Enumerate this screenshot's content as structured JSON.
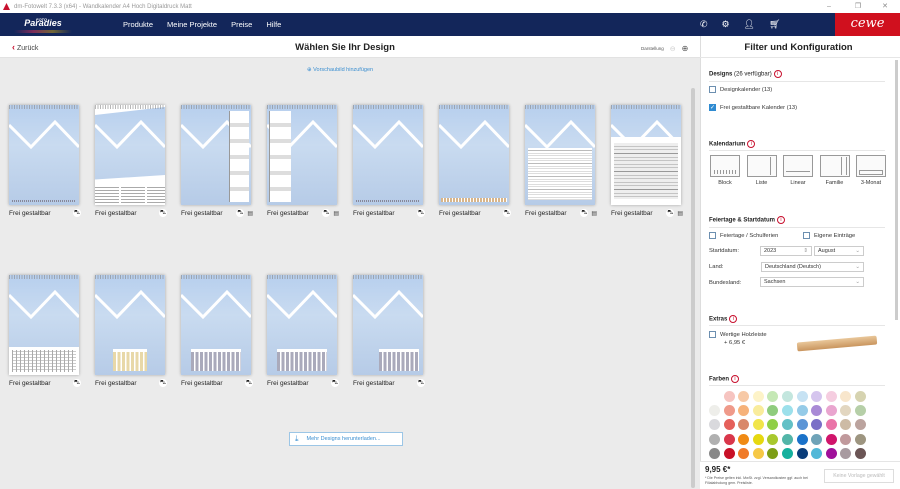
{
  "window": {
    "title": "dm-Fotowelt 7.3.3 (x64) - Wandkalender A4 Hoch Digitaldruck Matt",
    "minimize": "–",
    "maximize": "❐",
    "close": "✕"
  },
  "nav": {
    "logo": "Paradies",
    "logo_top": "FOTO",
    "links": [
      "Produkte",
      "Meine Projekte",
      "Preise",
      "Hilfe"
    ],
    "brand": "cewe",
    "icons": [
      "phone-icon",
      "gear-icon",
      "user-icon",
      "cart-icon"
    ]
  },
  "subheader": {
    "back": "Zurück",
    "title": "Wählen Sie Ihr Design",
    "zoom_label": "Darstellung"
  },
  "main": {
    "add_preview": "Vorschaubild hinzufügen",
    "more_designs": "Mehr Designs herunterladen...",
    "cards": [
      {
        "label": "Frei gestaltbar",
        "variant": "plain",
        "extra_icon": false
      },
      {
        "label": "Frei gestaltbar",
        "variant": "calendar-bottom",
        "extra_icon": false
      },
      {
        "label": "Frei gestaltbar",
        "variant": "list-right",
        "extra_icon": true
      },
      {
        "label": "Frei gestaltbar",
        "variant": "list-left",
        "extra_icon": true
      },
      {
        "label": "Frei gestaltbar",
        "variant": "plain",
        "extra_icon": false
      },
      {
        "label": "Frei gestaltbar",
        "variant": "linear",
        "extra_icon": false
      },
      {
        "label": "Frei gestaltbar",
        "variant": "planner",
        "extra_icon": true
      },
      {
        "label": "Frei gestaltbar",
        "variant": "family",
        "extra_icon": true
      },
      {
        "label": "Frei gestaltbar",
        "variant": "three-month",
        "extra_icon": false
      },
      {
        "label": "Frei gestaltbar",
        "variant": "block-small",
        "extra_icon": false
      },
      {
        "label": "Frei gestaltbar",
        "variant": "block",
        "extra_icon": false
      },
      {
        "label": "Frei gestaltbar",
        "variant": "block",
        "extra_icon": false
      },
      {
        "label": "Frei gestaltbar",
        "variant": "block-right",
        "extra_icon": false
      }
    ]
  },
  "panel": {
    "title": "Filter und Konfiguration",
    "designs": {
      "heading": "Designs",
      "count": "(26 verfügbar)",
      "options": [
        {
          "label": "Designkalender (13)",
          "checked": false
        },
        {
          "label": "Frei gestaltbare Kalender (13)",
          "checked": true
        }
      ]
    },
    "kalendarium": {
      "heading": "Kalendarium",
      "types": [
        "Block",
        "Liste",
        "Linear",
        "Familie",
        "3-Monat"
      ]
    },
    "feiertage": {
      "heading": "Feiertage & Startdatum",
      "holidays": "Feiertage / Schulferien",
      "own": "Eigene Einträge",
      "start_label": "Startdatum:",
      "year": "2023",
      "month": "August",
      "country_label": "Land:",
      "country": "Deutschland (Deutsch)",
      "state_label": "Bundesland:",
      "state": "Sachsen"
    },
    "extras": {
      "heading": "Extras",
      "item": "Wertige Holzleiste",
      "price": "+ 6,95 €"
    },
    "farben": {
      "heading": "Farben",
      "colors": [
        "#ffffff",
        "#f6c4c0",
        "#f7c9a6",
        "#fdf3c8",
        "#c5e8b5",
        "#c3e6de",
        "#c6e2f3",
        "#d5c5ee",
        "#f5cde0",
        "#f8e6cc",
        "#d6d3b0",
        "#eeeeea",
        "#ef9a8a",
        "#f6b27a",
        "#f9ec9c",
        "#8fcc7d",
        "#9ce0eb",
        "#95cbe8",
        "#a98ad6",
        "#e9a5cf",
        "#e2d6c0",
        "#b6cfa8",
        "#d9d9dd",
        "#e5605a",
        "#d9886a",
        "#f1e54a",
        "#8fcf46",
        "#62c0c6",
        "#5b95d6",
        "#7a6fc7",
        "#ea74a8",
        "#cdbba5",
        "#bba39e",
        "#b0b0b0",
        "#d9374b",
        "#f08a14",
        "#e6d810",
        "#a8c82e",
        "#53b5a8",
        "#1a72c9",
        "#6fa3b8",
        "#d0156b",
        "#c0999c",
        "#9d9580",
        "#888888",
        "#c81027",
        "#f07a28",
        "#f6c846",
        "#7d9e16",
        "#15b09e",
        "#0a3d7a",
        "#52b8d8",
        "#a0109a",
        "#a89aa0",
        "#6b5555"
      ]
    },
    "footer": {
      "price": "9,95 €*",
      "note": "* Die Preise gelten inkl. MwSt. zzgl. Versandkosten ggf. auch bei Filialabholung gem. Preisliste.",
      "button": "Keine Vorlage gewählt"
    }
  }
}
